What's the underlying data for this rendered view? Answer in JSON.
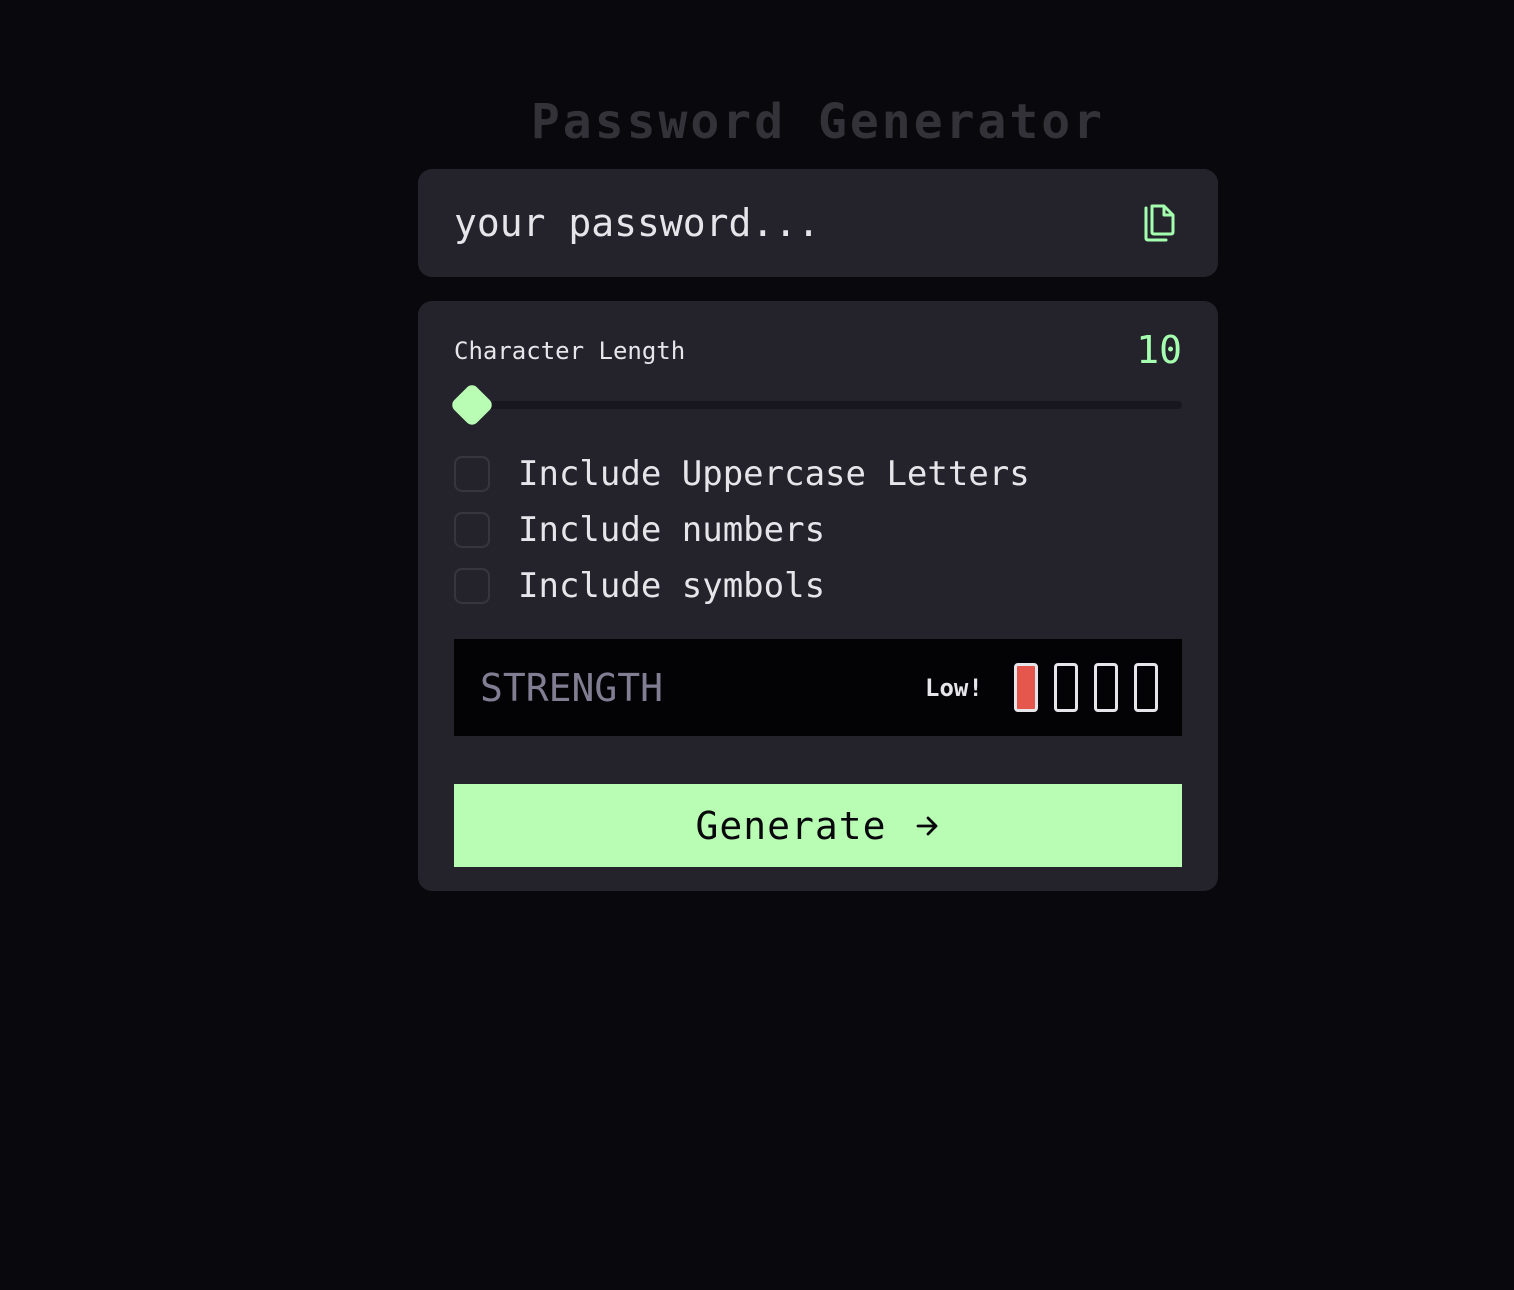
{
  "page_title": "Password Generator",
  "output": {
    "placeholder": "your password...",
    "copy_icon": "copy-icon"
  },
  "settings": {
    "length_label": "Character Length",
    "length_value": "10",
    "slider": {
      "min": 10,
      "max": 20,
      "value": 10
    },
    "options": [
      {
        "label": "Include Uppercase Letters",
        "checked": false
      },
      {
        "label": "Include numbers",
        "checked": false
      },
      {
        "label": "Include symbols",
        "checked": false
      }
    ]
  },
  "strength": {
    "label": "STRENGTH",
    "level": "Low!",
    "bars_filled": 1,
    "bars_total": 4,
    "color": "#e5564d"
  },
  "generate": {
    "label": "Generate",
    "icon": "arrow-right-icon"
  },
  "colors": {
    "accent": "#a4ffaf",
    "background": "#08080d",
    "panel": "#24232c",
    "strength_low": "#e5564d"
  }
}
